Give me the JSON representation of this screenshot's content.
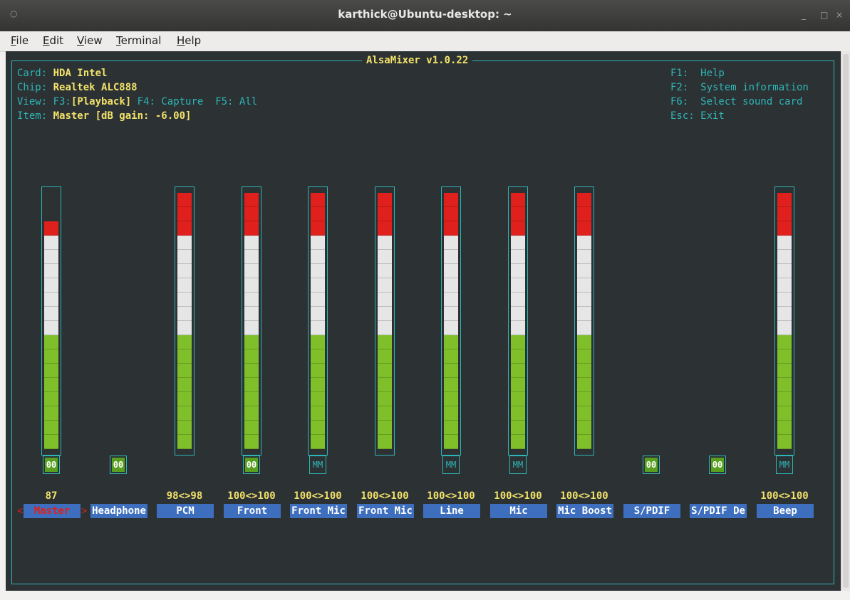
{
  "window": {
    "title": "karthick@Ubuntu-desktop: ~",
    "menu_dot": "○",
    "min": "_",
    "max": "□",
    "close": "×"
  },
  "menu": [
    {
      "label": "File",
      "key": "F",
      "rest": "ile"
    },
    {
      "label": "Edit",
      "key": "E",
      "rest": "dit"
    },
    {
      "label": "View",
      "key": "V",
      "rest": "iew"
    },
    {
      "label": "Terminal",
      "key": "T",
      "rest": "erminal"
    },
    {
      "label": "Help",
      "key": "H",
      "rest": "elp"
    }
  ],
  "app_title": "AlsaMixer v1.0.22",
  "info": {
    "card_label": "Card:",
    "card": "HDA Intel",
    "chip_label": "Chip:",
    "chip": "Realtek ALC888",
    "view_label": "View:",
    "view_f3": "F3:",
    "view_playback": "[Playback]",
    "view_rest": " F4: Capture  F5: All",
    "item_label": "Item:",
    "item": "Master [dB gain: -6.00]"
  },
  "fkeys": [
    "F1:  Help",
    "F2:  System information",
    "F6:  Select sound card",
    "Esc: Exit"
  ],
  "selection_arrows": {
    "left": "<",
    "right": ">"
  },
  "colors": {
    "accent": "#2fb5b5",
    "highlight": "#f2e26a",
    "label_bg": "#3d6fbe",
    "level_red": "#e0201c",
    "level_white": "#e6e6e6",
    "level_green": "#7fbf2a"
  },
  "channels": [
    {
      "name": "Master",
      "volume": "87",
      "level": 0.87,
      "has_fader": true,
      "mute": "00",
      "mute_on": true,
      "selected": true
    },
    {
      "name": "Headphone",
      "volume": "",
      "level": 0,
      "has_fader": false,
      "mute": "00",
      "mute_on": true,
      "selected": false
    },
    {
      "name": "PCM",
      "volume": "98<>98",
      "level": 0.98,
      "has_fader": true,
      "mute": "",
      "mute_on": false,
      "selected": false
    },
    {
      "name": "Front",
      "volume": "100<>100",
      "level": 1.0,
      "has_fader": true,
      "mute": "00",
      "mute_on": true,
      "selected": false
    },
    {
      "name": "Front Mic",
      "volume": "100<>100",
      "level": 1.0,
      "has_fader": true,
      "mute": "MM",
      "mute_on": false,
      "selected": false
    },
    {
      "name": "Front Mic",
      "volume": "100<>100",
      "level": 1.0,
      "has_fader": true,
      "mute": "",
      "mute_on": false,
      "selected": false
    },
    {
      "name": "Line",
      "volume": "100<>100",
      "level": 1.0,
      "has_fader": true,
      "mute": "MM",
      "mute_on": false,
      "selected": false
    },
    {
      "name": "Mic",
      "volume": "100<>100",
      "level": 1.0,
      "has_fader": true,
      "mute": "MM",
      "mute_on": false,
      "selected": false
    },
    {
      "name": "Mic Boost",
      "volume": "100<>100",
      "level": 1.0,
      "has_fader": true,
      "mute": "",
      "mute_on": false,
      "selected": false
    },
    {
      "name": "S/PDIF",
      "volume": "",
      "level": 0,
      "has_fader": false,
      "mute": "00",
      "mute_on": true,
      "selected": false
    },
    {
      "name": "S/PDIF De",
      "volume": "",
      "level": 0,
      "has_fader": false,
      "mute": "00",
      "mute_on": true,
      "selected": false
    },
    {
      "name": "Beep",
      "volume": "100<>100",
      "level": 1.0,
      "has_fader": true,
      "mute": "MM",
      "mute_on": false,
      "selected": false
    }
  ]
}
